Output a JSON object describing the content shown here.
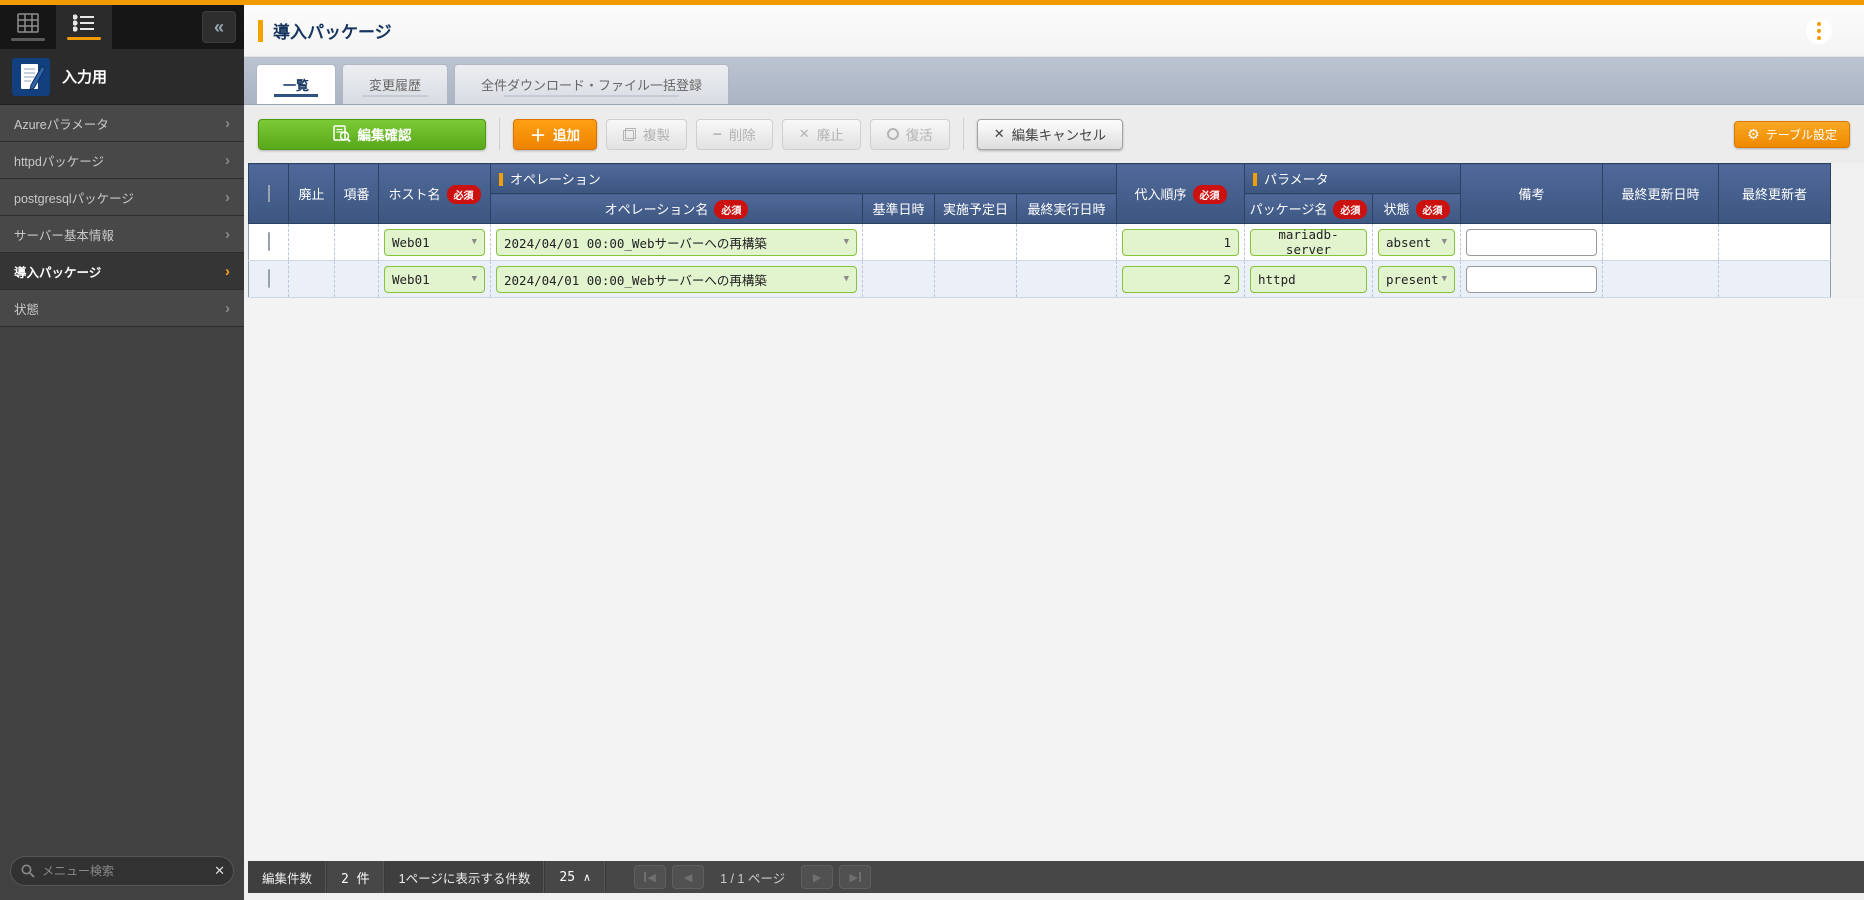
{
  "colors": {
    "accent_orange": "#f29b00",
    "button_green": "#58a81b",
    "header_blue": "#3c5680",
    "required_red": "#cc1111"
  },
  "sidebar": {
    "section": {
      "title": "入力用"
    },
    "items": [
      {
        "label": "Azureパラメータ"
      },
      {
        "label": "httpdパッケージ"
      },
      {
        "label": "postgresqlパッケージ"
      },
      {
        "label": "サーバー基本情報"
      },
      {
        "label": "導入パッケージ"
      },
      {
        "label": "状態"
      }
    ],
    "search": {
      "placeholder": "メニュー検索"
    }
  },
  "header": {
    "title": "導入パッケージ"
  },
  "tabs": [
    {
      "label": "一覧"
    },
    {
      "label": "変更履歴"
    },
    {
      "label": "全件ダウンロード・ファイル一括登録"
    }
  ],
  "toolbar": {
    "edit_confirm": "編集確認",
    "add": "追加",
    "duplicate": "複製",
    "delete": "削除",
    "discard": "廃止",
    "restore": "復活",
    "cancel": "編集キャンセル",
    "table_settings": "テーブル設定"
  },
  "table": {
    "required_badge": "必須",
    "headers": {
      "discard": "廃止",
      "item_no": "項番",
      "host": "ホスト名",
      "operation_group": "オペレーション",
      "operation_name": "オペレーション名",
      "base_datetime": "基準日時",
      "scheduled_date": "実施予定日",
      "last_run": "最終実行日時",
      "order": "代入順序",
      "parameter_group": "パラメータ",
      "package": "パッケージ名",
      "state": "状態",
      "note": "備考",
      "updated": "最終更新日時",
      "updater": "最終更新者"
    },
    "rows": [
      {
        "host": "Web01",
        "operation": "2024/04/01 00:00_Webサーバーへの再構築",
        "order": "1",
        "package": "mariadb-server",
        "state": "absent",
        "note": ""
      },
      {
        "host": "Web01",
        "operation": "2024/04/01 00:00_Webサーバーへの再構築",
        "order": "2",
        "package": "httpd",
        "state": "present",
        "note": ""
      }
    ]
  },
  "footer": {
    "edit_count_label": "編集件数",
    "edit_count_value": "2 件",
    "per_page_label": "1ページに表示する件数",
    "per_page_value": "25",
    "page_info": "1 / 1 ページ"
  }
}
